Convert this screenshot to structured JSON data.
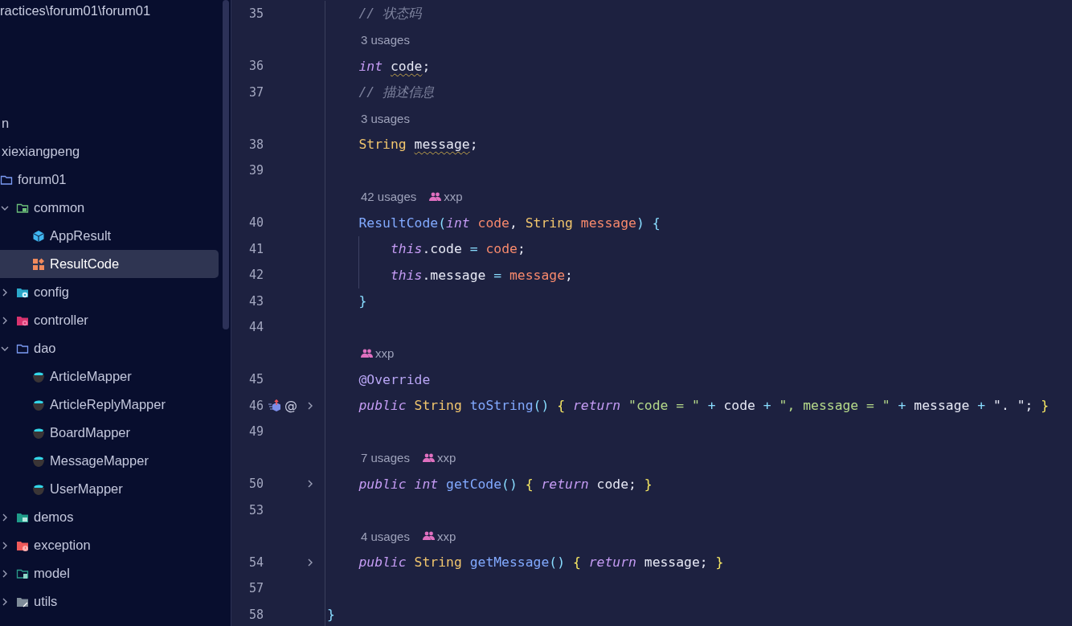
{
  "project_panel": {
    "path_fragment": "ractices\\forum01\\forum01",
    "tree": [
      {
        "label": "n",
        "selected": false
      },
      {
        "label": "xiexiangpeng",
        "selected": false,
        "children": [
          {
            "label": "forum01",
            "kind": "folder",
            "selected": false,
            "children": [
              {
                "label": "common",
                "kind": "package-folder",
                "expanded": true,
                "selected": false,
                "children": [
                  {
                    "label": "AppResult",
                    "kind": "class",
                    "selected": false
                  },
                  {
                    "label": "ResultCode",
                    "kind": "enum",
                    "selected": true
                  }
                ]
              },
              {
                "label": "config",
                "kind": "config-folder",
                "expanded": false,
                "selected": false
              },
              {
                "label": "controller",
                "kind": "controller-folder",
                "expanded": false,
                "selected": false
              },
              {
                "label": "dao",
                "kind": "folder",
                "expanded": true,
                "selected": false,
                "children": [
                  {
                    "label": "ArticleMapper",
                    "kind": "mapper",
                    "selected": false
                  },
                  {
                    "label": "ArticleReplyMapper",
                    "kind": "mapper",
                    "selected": false
                  },
                  {
                    "label": "BoardMapper",
                    "kind": "mapper",
                    "selected": false
                  },
                  {
                    "label": "MessageMapper",
                    "kind": "mapper",
                    "selected": false
                  },
                  {
                    "label": "UserMapper",
                    "kind": "mapper",
                    "selected": false
                  }
                ]
              },
              {
                "label": "demos",
                "kind": "demos-folder",
                "expanded": false,
                "selected": false
              },
              {
                "label": "exception",
                "kind": "exception-folder",
                "expanded": false,
                "selected": false
              },
              {
                "label": "model",
                "kind": "model-folder",
                "expanded": false,
                "selected": false
              },
              {
                "label": "utils",
                "kind": "utils-folder",
                "expanded": false,
                "selected": false
              }
            ]
          }
        ]
      }
    ]
  },
  "editor": {
    "rows": [
      {
        "kind": "code",
        "number": "35",
        "tokens": [
          {
            "kind": "c",
            "text": "    // 状态码"
          }
        ]
      },
      {
        "kind": "hint",
        "usages": "3 usages"
      },
      {
        "kind": "code",
        "number": "36",
        "tokens": [
          {
            "kind": "k",
            "text": "    int "
          },
          {
            "kind": "w",
            "text": "code"
          },
          {
            "kind": "p",
            "text": ";"
          }
        ]
      },
      {
        "kind": "code",
        "number": "37",
        "tokens": [
          {
            "kind": "c",
            "text": "    // 描述信息"
          }
        ]
      },
      {
        "kind": "hint",
        "usages": "3 usages"
      },
      {
        "kind": "code",
        "number": "38",
        "tokens": [
          {
            "kind": "ty",
            "text": "    String "
          },
          {
            "kind": "w",
            "text": "message"
          },
          {
            "kind": "p",
            "text": ";"
          }
        ]
      },
      {
        "kind": "code",
        "number": "39",
        "tokens": []
      },
      {
        "kind": "hint",
        "usages": "42 usages",
        "author": "xxp"
      },
      {
        "kind": "code",
        "number": "40",
        "tokens": [
          {
            "kind": "f",
            "text": "    ResultCode"
          },
          {
            "kind": "o",
            "text": "("
          },
          {
            "kind": "k",
            "text": "int "
          },
          {
            "kind": "v",
            "text": "code"
          },
          {
            "kind": "p",
            "text": ", "
          },
          {
            "kind": "ty",
            "text": "String "
          },
          {
            "kind": "v",
            "text": "message"
          },
          {
            "kind": "o",
            "text": ") {"
          }
        ]
      },
      {
        "kind": "code",
        "number": "41",
        "tokens": [
          {
            "kind": "k",
            "text": "        this"
          },
          {
            "kind": "p",
            "text": ".code "
          },
          {
            "kind": "o",
            "text": "= "
          },
          {
            "kind": "v",
            "text": "code"
          },
          {
            "kind": "p",
            "text": ";"
          }
        ]
      },
      {
        "kind": "code",
        "number": "42",
        "tokens": [
          {
            "kind": "k",
            "text": "        this"
          },
          {
            "kind": "p",
            "text": ".message "
          },
          {
            "kind": "o",
            "text": "= "
          },
          {
            "kind": "v",
            "text": "message"
          },
          {
            "kind": "p",
            "text": ";"
          }
        ]
      },
      {
        "kind": "code",
        "number": "43",
        "tokens": [
          {
            "kind": "o",
            "text": "    }"
          }
        ]
      },
      {
        "kind": "code",
        "number": "44",
        "tokens": []
      },
      {
        "kind": "hint",
        "author": "xxp"
      },
      {
        "kind": "code",
        "number": "45",
        "tokens": [
          {
            "kind": "a",
            "text": "    @Override"
          }
        ]
      },
      {
        "kind": "code",
        "number": "46",
        "override_marker": true,
        "gutter_mark": "@",
        "folded": true,
        "tokens": [
          {
            "kind": "k",
            "text": "    public "
          },
          {
            "kind": "ty",
            "text": "String "
          },
          {
            "kind": "f",
            "text": "toString"
          },
          {
            "kind": "o",
            "text": "() "
          },
          {
            "kind": "b",
            "text": "{ "
          },
          {
            "kind": "k",
            "text": "return "
          },
          {
            "kind": "s",
            "text": "\"code = \" "
          },
          {
            "kind": "o",
            "text": "+ "
          },
          {
            "kind": "p",
            "text": "code "
          },
          {
            "kind": "o",
            "text": "+ "
          },
          {
            "kind": "s",
            "text": "\", message = \" "
          },
          {
            "kind": "o",
            "text": "+ "
          },
          {
            "kind": "p",
            "text": "message "
          },
          {
            "kind": "o",
            "text": "+ "
          },
          {
            "kind": "p",
            "text": "\". \"; "
          },
          {
            "kind": "b",
            "text": "}"
          }
        ]
      },
      {
        "kind": "code",
        "number": "49",
        "tokens": []
      },
      {
        "kind": "hint",
        "usages": "7 usages",
        "author": "xxp"
      },
      {
        "kind": "code",
        "number": "50",
        "folded": true,
        "tokens": [
          {
            "kind": "k",
            "text": "    public int "
          },
          {
            "kind": "f",
            "text": "getCode"
          },
          {
            "kind": "o",
            "text": "() "
          },
          {
            "kind": "b",
            "text": "{ "
          },
          {
            "kind": "k",
            "text": "return "
          },
          {
            "kind": "p",
            "text": "code; "
          },
          {
            "kind": "b",
            "text": "}"
          }
        ]
      },
      {
        "kind": "code",
        "number": "53",
        "tokens": []
      },
      {
        "kind": "hint",
        "usages": "4 usages",
        "author": "xxp"
      },
      {
        "kind": "code",
        "number": "54",
        "folded": true,
        "tokens": [
          {
            "kind": "k",
            "text": "    public "
          },
          {
            "kind": "ty",
            "text": "String "
          },
          {
            "kind": "f",
            "text": "getMessage"
          },
          {
            "kind": "o",
            "text": "() "
          },
          {
            "kind": "b",
            "text": "{ "
          },
          {
            "kind": "k",
            "text": "return "
          },
          {
            "kind": "p",
            "text": "message; "
          },
          {
            "kind": "b",
            "text": "}"
          }
        ]
      },
      {
        "kind": "code",
        "number": "57",
        "tokens": []
      },
      {
        "kind": "code",
        "number": "58",
        "tokens": [
          {
            "kind": "o",
            "text": "}"
          }
        ]
      }
    ]
  }
}
